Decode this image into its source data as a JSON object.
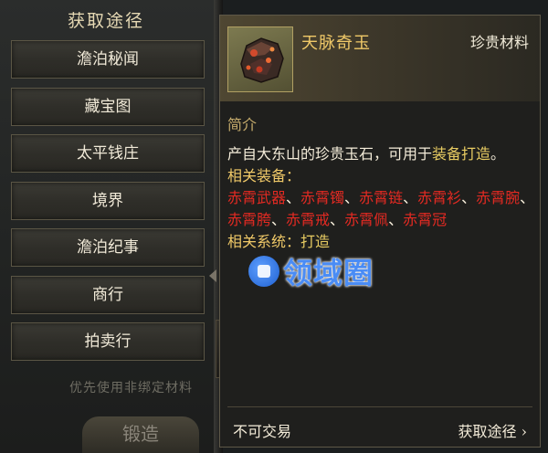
{
  "acquisition": {
    "title": "获取途径",
    "buttons": [
      "澹泊秘闻",
      "藏宝图",
      "太平钱庄",
      "境界",
      "澹泊纪事",
      "商行",
      "拍卖行"
    ],
    "prefer_note": "优先使用非绑定材料",
    "forge_label": "锻造"
  },
  "item": {
    "name": "天脉奇玉",
    "category": "珍贵材料",
    "intro_heading": "简介",
    "desc_plain": "产自大东山的珍贵玉石，可用于",
    "desc_highlight": "装备打造",
    "desc_end": "。",
    "related_equip_label": "相关装备：",
    "related_equip": [
      "赤霄武器",
      "赤霄镯",
      "赤霄链",
      "赤霄衫",
      "赤霄腕",
      "赤霄胯",
      "赤霄戒",
      "赤霄佩",
      "赤霄冠"
    ],
    "separator": "、",
    "related_system_label": "相关系统：",
    "related_system": "打造",
    "trade_status": "不可交易",
    "acquire_link": "获取途径",
    "acquire_arrow": "›"
  },
  "watermark": {
    "text": "领域圈"
  },
  "colors": {
    "item_name": "#f0c968",
    "related_item": "#e42a22",
    "highlight": "#e8cc62"
  },
  "icons": {
    "item": "jade-ore-icon",
    "arrow": "chevron-right-icon"
  }
}
